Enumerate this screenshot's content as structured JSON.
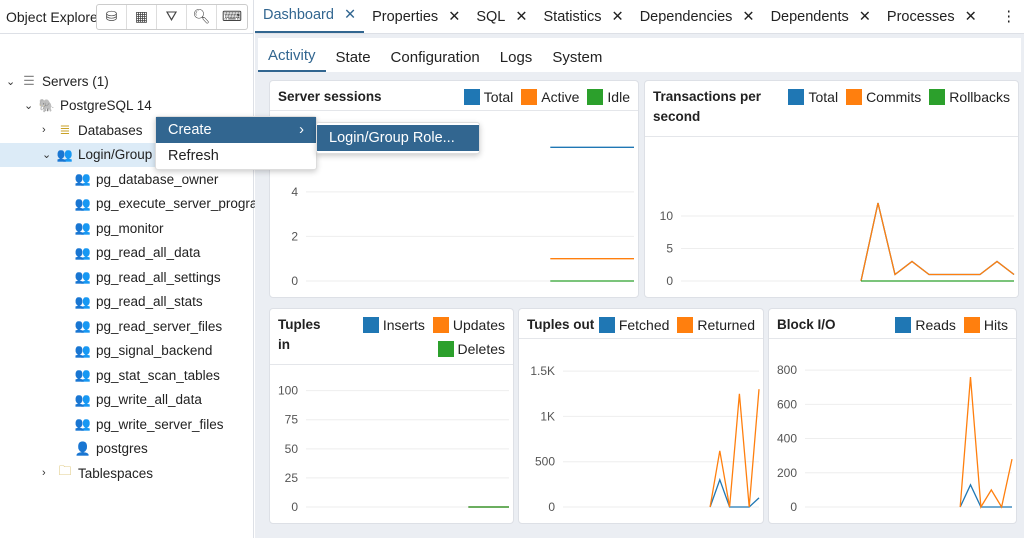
{
  "explorer": {
    "title": "Object Explorer",
    "toolbar": [
      "database-icon",
      "table-icon",
      "filter-icon",
      "search-icon",
      "terminal-icon"
    ],
    "tree": [
      {
        "label": "Servers (1)",
        "level": 0,
        "chev": "v",
        "icon": "servers-icon",
        "glyph": "☰",
        "color": "#888"
      },
      {
        "label": "PostgreSQL 14",
        "level": 1,
        "chev": "v",
        "icon": "postgres-elephant-icon",
        "glyph": "🐘",
        "color": "#336791"
      },
      {
        "label": "Databases",
        "level": 2,
        "chev": ">",
        "icon": "databases-icon",
        "glyph": "≣",
        "color": "#c9a227"
      },
      {
        "label": "Login/Group Roles",
        "level": 2,
        "chev": "v",
        "icon": "group-roles-icon",
        "glyph": "👥",
        "color": "#d33",
        "selected": true
      },
      {
        "label": "pg_database_owner",
        "level": 3,
        "icon": "group-role-icon",
        "glyph": "👥"
      },
      {
        "label": "pg_execute_server_program",
        "level": 3,
        "icon": "group-role-icon",
        "glyph": "👥"
      },
      {
        "label": "pg_monitor",
        "level": 3,
        "icon": "group-role-icon",
        "glyph": "👥"
      },
      {
        "label": "pg_read_all_data",
        "level": 3,
        "icon": "group-role-icon",
        "glyph": "👥"
      },
      {
        "label": "pg_read_all_settings",
        "level": 3,
        "icon": "group-role-icon",
        "glyph": "👥"
      },
      {
        "label": "pg_read_all_stats",
        "level": 3,
        "icon": "group-role-icon",
        "glyph": "👥"
      },
      {
        "label": "pg_read_server_files",
        "level": 3,
        "icon": "group-role-icon",
        "glyph": "👥"
      },
      {
        "label": "pg_signal_backend",
        "level": 3,
        "icon": "group-role-icon",
        "glyph": "👥"
      },
      {
        "label": "pg_stat_scan_tables",
        "level": 3,
        "icon": "group-role-icon",
        "glyph": "👥"
      },
      {
        "label": "pg_write_all_data",
        "level": 3,
        "icon": "group-role-icon",
        "glyph": "👥"
      },
      {
        "label": "pg_write_server_files",
        "level": 3,
        "icon": "group-role-icon",
        "glyph": "👥"
      },
      {
        "label": "postgres",
        "level": 3,
        "icon": "login-role-icon",
        "glyph": "👤"
      },
      {
        "label": "Tablespaces",
        "level": 2,
        "chev": ">",
        "icon": "tablespaces-icon",
        "glyph": "🗀",
        "color": "#c9a227"
      }
    ]
  },
  "context_menu": {
    "items": [
      "Create",
      "Refresh"
    ],
    "submenu": [
      "Login/Group Role..."
    ]
  },
  "tabs": [
    "Dashboard",
    "Properties",
    "SQL",
    "Statistics",
    "Dependencies",
    "Dependents",
    "Processes"
  ],
  "subtabs": [
    "Activity",
    "State",
    "Configuration",
    "Logs",
    "System"
  ],
  "colors": {
    "blue": "#1f77b4",
    "orange": "#ff7f0e",
    "green": "#2ca02c"
  },
  "chart_data": [
    {
      "type": "line",
      "title": "Server sessions",
      "yticks": [
        "0",
        "2",
        "4"
      ],
      "ylim": [
        0,
        7
      ],
      "series": [
        {
          "name": "Total",
          "color": "#1f77b4",
          "values": [
            null,
            null,
            null,
            null,
            null,
            null,
            null,
            null,
            null,
            null,
            null,
            null,
            null,
            null,
            6,
            6,
            6,
            6,
            6,
            6
          ]
        },
        {
          "name": "Active",
          "color": "#ff7f0e",
          "values": [
            null,
            null,
            null,
            null,
            null,
            null,
            null,
            null,
            null,
            null,
            null,
            null,
            null,
            null,
            1,
            1,
            1,
            1,
            1,
            1
          ]
        },
        {
          "name": "Idle",
          "color": "#2ca02c",
          "values": [
            null,
            null,
            null,
            null,
            null,
            null,
            null,
            null,
            null,
            null,
            null,
            null,
            null,
            null,
            0,
            0,
            0,
            0,
            0,
            0
          ]
        }
      ]
    },
    {
      "type": "line",
      "title": "Transactions per second",
      "yticks": [
        "0",
        "5",
        "10"
      ],
      "ylim": [
        0,
        20
      ],
      "series": [
        {
          "name": "Total",
          "color": "#1f77b4",
          "values": [
            null,
            null,
            null,
            null,
            null,
            null,
            null,
            null,
            null,
            null,
            0,
            12,
            1,
            3,
            1,
            1,
            1,
            1,
            3,
            1
          ]
        },
        {
          "name": "Commits",
          "color": "#ff7f0e",
          "values": [
            null,
            null,
            null,
            null,
            null,
            null,
            null,
            null,
            null,
            null,
            0,
            12,
            1,
            3,
            1,
            1,
            1,
            1,
            3,
            1
          ]
        },
        {
          "name": "Rollbacks",
          "color": "#2ca02c",
          "values": [
            null,
            null,
            null,
            null,
            null,
            null,
            null,
            null,
            null,
            null,
            0,
            0,
            0,
            0,
            0,
            0,
            0,
            0,
            0,
            0
          ]
        }
      ]
    },
    {
      "type": "line",
      "title": "Tuples in",
      "yticks": [
        "0",
        "25",
        "50",
        "75",
        "100"
      ],
      "ylim": [
        0,
        110
      ],
      "series": [
        {
          "name": "Inserts",
          "color": "#1f77b4",
          "values": [
            null,
            null,
            null,
            null,
            null,
            null,
            null,
            null,
            null,
            null,
            null,
            null,
            null,
            null,
            null,
            0,
            0,
            0,
            0,
            0
          ]
        },
        {
          "name": "Updates",
          "color": "#ff7f0e",
          "values": [
            null,
            null,
            null,
            null,
            null,
            null,
            null,
            null,
            null,
            null,
            null,
            null,
            null,
            null,
            null,
            0,
            0,
            0,
            0,
            0
          ]
        },
        {
          "name": "Deletes",
          "color": "#2ca02c",
          "values": [
            null,
            null,
            null,
            null,
            null,
            null,
            null,
            null,
            null,
            null,
            null,
            null,
            null,
            null,
            null,
            0,
            0,
            0,
            0,
            0
          ]
        }
      ]
    },
    {
      "type": "line",
      "title": "Tuples out",
      "yticks": [
        "0",
        "500",
        "1K",
        "1.5K"
      ],
      "ylim": [
        0,
        1700
      ],
      "series": [
        {
          "name": "Fetched",
          "color": "#1f77b4",
          "values": [
            null,
            null,
            null,
            null,
            null,
            null,
            null,
            null,
            null,
            null,
            null,
            null,
            null,
            null,
            0,
            300,
            0,
            0,
            0,
            100
          ]
        },
        {
          "name": "Returned",
          "color": "#ff7f0e",
          "values": [
            null,
            null,
            null,
            null,
            null,
            null,
            null,
            null,
            null,
            null,
            null,
            null,
            null,
            null,
            0,
            620,
            0,
            1250,
            0,
            1300
          ]
        }
      ]
    },
    {
      "type": "line",
      "title": "Block I/O",
      "yticks": [
        "0",
        "200",
        "400",
        "600",
        "800"
      ],
      "ylim": [
        0,
        900
      ],
      "series": [
        {
          "name": "Reads",
          "color": "#1f77b4",
          "values": [
            null,
            null,
            null,
            null,
            null,
            null,
            null,
            null,
            null,
            null,
            null,
            null,
            null,
            null,
            0,
            130,
            0,
            0,
            0,
            0
          ]
        },
        {
          "name": "Hits",
          "color": "#ff7f0e",
          "values": [
            null,
            null,
            null,
            null,
            null,
            null,
            null,
            null,
            null,
            null,
            null,
            null,
            null,
            null,
            0,
            760,
            0,
            100,
            0,
            280
          ]
        }
      ]
    }
  ]
}
